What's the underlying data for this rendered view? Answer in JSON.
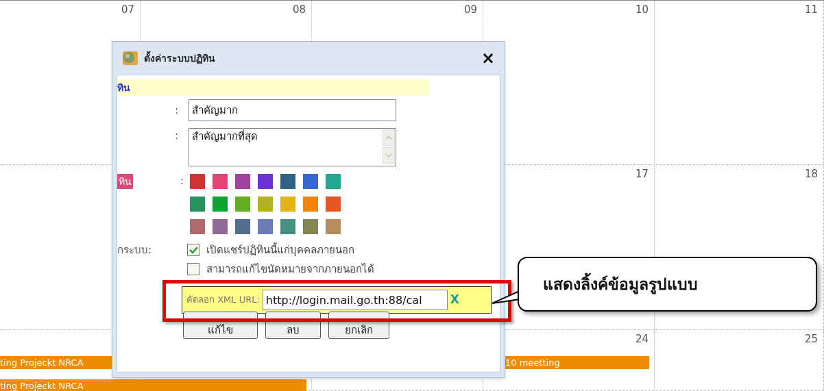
{
  "calendar": {
    "weeks": [
      {
        "dates": [
          "07",
          "08",
          "09",
          "10",
          "11"
        ]
      },
      {
        "dates": [
          "17",
          "18"
        ]
      },
      {
        "dates": [
          "24",
          "25"
        ],
        "events": [
          {
            "title": "ting Projeckt NRCA",
            "kind": "plain"
          },
          {
            "title": "ting Projeckt NRCA",
            "kind": "plain"
          },
          {
            "title": "10 meetting",
            "kind": "continued"
          }
        ]
      }
    ]
  },
  "dialog": {
    "title": "ตั้งค่าระบบปฏิทิน",
    "close": "×",
    "section_header": "ทิน",
    "name_row": {
      "colon": ":",
      "value": "สำคัญมาก"
    },
    "description_row": {
      "colon": ":",
      "value": "สำคัญมากที่สุด"
    },
    "color_row": {
      "label": "ทิน",
      "colon": ":",
      "swatches": [
        {
          "color": "#d03232",
          "selected": false
        },
        {
          "color": "#e04474",
          "selected": false
        },
        {
          "color": "#a0429e",
          "selected": false
        },
        {
          "color": "#6a32d2",
          "selected": false
        },
        {
          "color": "#306285",
          "selected": false
        },
        {
          "color": "#3466d4",
          "selected": false
        },
        {
          "color": "#22a890",
          "selected": false
        },
        {
          "color": "#23925f",
          "selected": false
        },
        {
          "color": "#13a132",
          "selected": false
        },
        {
          "color": "#62b021",
          "selected": false
        },
        {
          "color": "#b1b122",
          "selected": false
        },
        {
          "color": "#e2b514",
          "selected": false
        },
        {
          "color": "#f28304",
          "selected": false
        },
        {
          "color": "#e35621",
          "selected": false
        },
        {
          "color": "#b06a6e",
          "selected": false
        },
        {
          "color": "#936a96",
          "selected": false
        },
        {
          "color": "#526d8d",
          "selected": false
        },
        {
          "color": "#6c7bb5",
          "selected": false
        },
        {
          "color": "#47907f",
          "selected": false
        },
        {
          "color": "#858552",
          "selected": false
        },
        {
          "color": "#b58c5c",
          "selected": false
        }
      ]
    },
    "sharing": {
      "label": "กระบบ:",
      "options": [
        {
          "label": "เปิดแชร์ปฏิทินนี้แก่บุคคลภายนอก",
          "checked": true
        },
        {
          "label": "สามารถแก้ไขนัดหมายจากภายนอกได้",
          "checked": false
        }
      ]
    },
    "xml": {
      "label": "คัดลอก XML URL:",
      "value": "http://login.mail.go.th:88/cal",
      "clear": "X"
    },
    "buttons": [
      "แก้ไข",
      "ลบ",
      "ยกเลิก"
    ]
  },
  "callout": {
    "text": "แสดงลิ้งค์ข้อมูลรูปแบบ"
  }
}
